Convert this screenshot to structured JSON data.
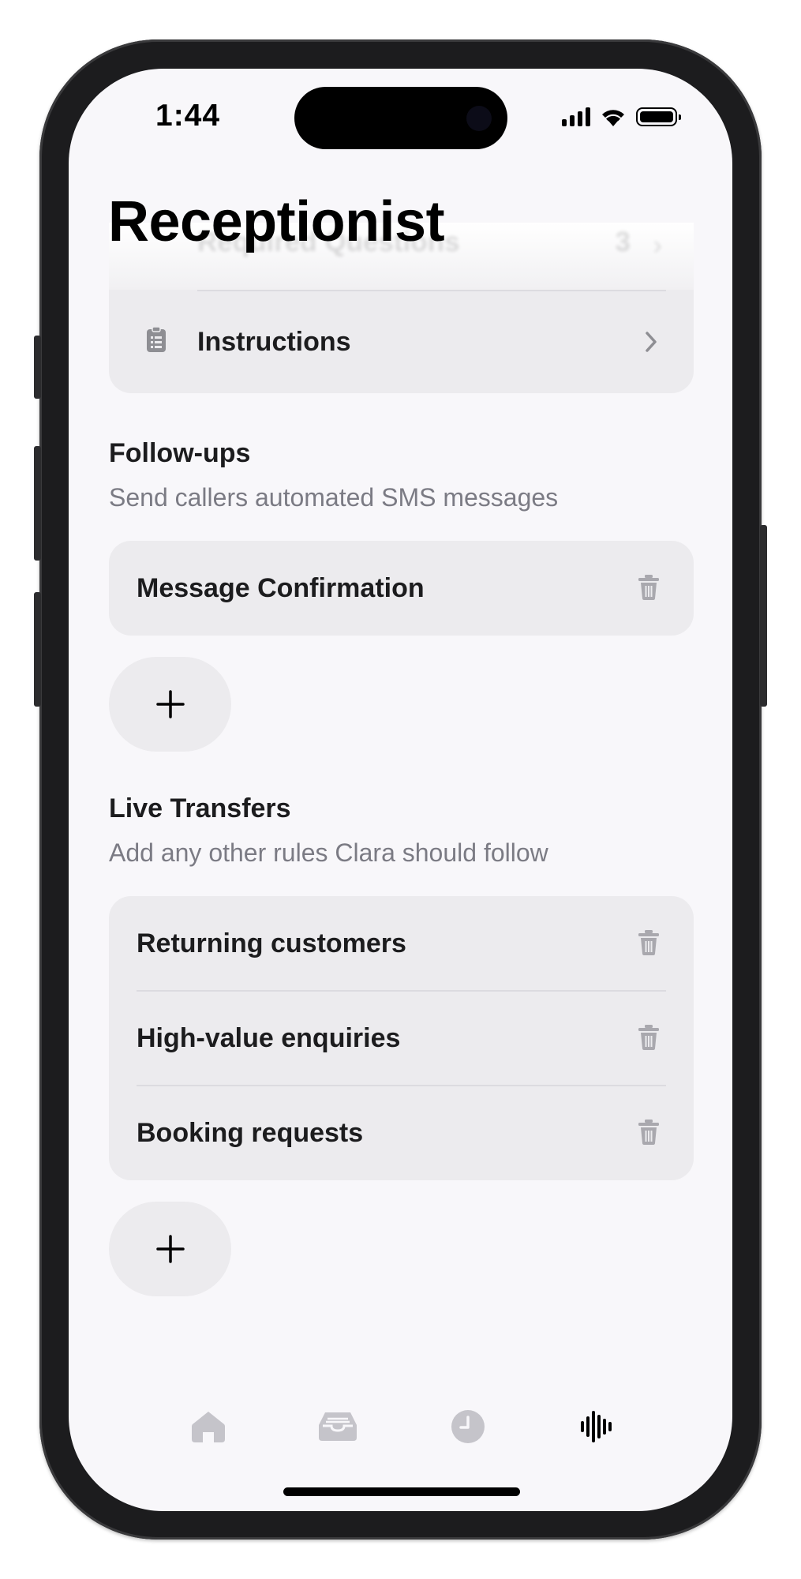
{
  "status_bar": {
    "time": "1:44"
  },
  "page_title": "Receptionist",
  "previous_section": {
    "rows": [
      {
        "label": "Required Questions",
        "count": "3"
      },
      {
        "label": "Instructions"
      }
    ]
  },
  "follow_ups": {
    "title": "Follow-ups",
    "subtitle": "Send callers automated SMS messages",
    "items": [
      {
        "label": "Message Confirmation"
      }
    ]
  },
  "live_transfers": {
    "title": "Live Transfers",
    "subtitle": "Add any other rules Clara should follow",
    "items": [
      {
        "label": "Returning customers"
      },
      {
        "label": "High-value enquiries"
      },
      {
        "label": "Booking requests"
      }
    ]
  },
  "tab_bar": {
    "tabs": [
      {
        "icon": "house-icon",
        "active": false
      },
      {
        "icon": "inbox-tray-icon",
        "active": false
      },
      {
        "icon": "clock-icon",
        "active": false
      },
      {
        "icon": "waveform-icon",
        "active": true
      }
    ]
  },
  "colors": {
    "background": "#f8f7fa",
    "card": "#ecebee",
    "secondary_text": "#7b7b84",
    "inactive_icon": "#c5c4ca",
    "active_icon": "#000000"
  }
}
